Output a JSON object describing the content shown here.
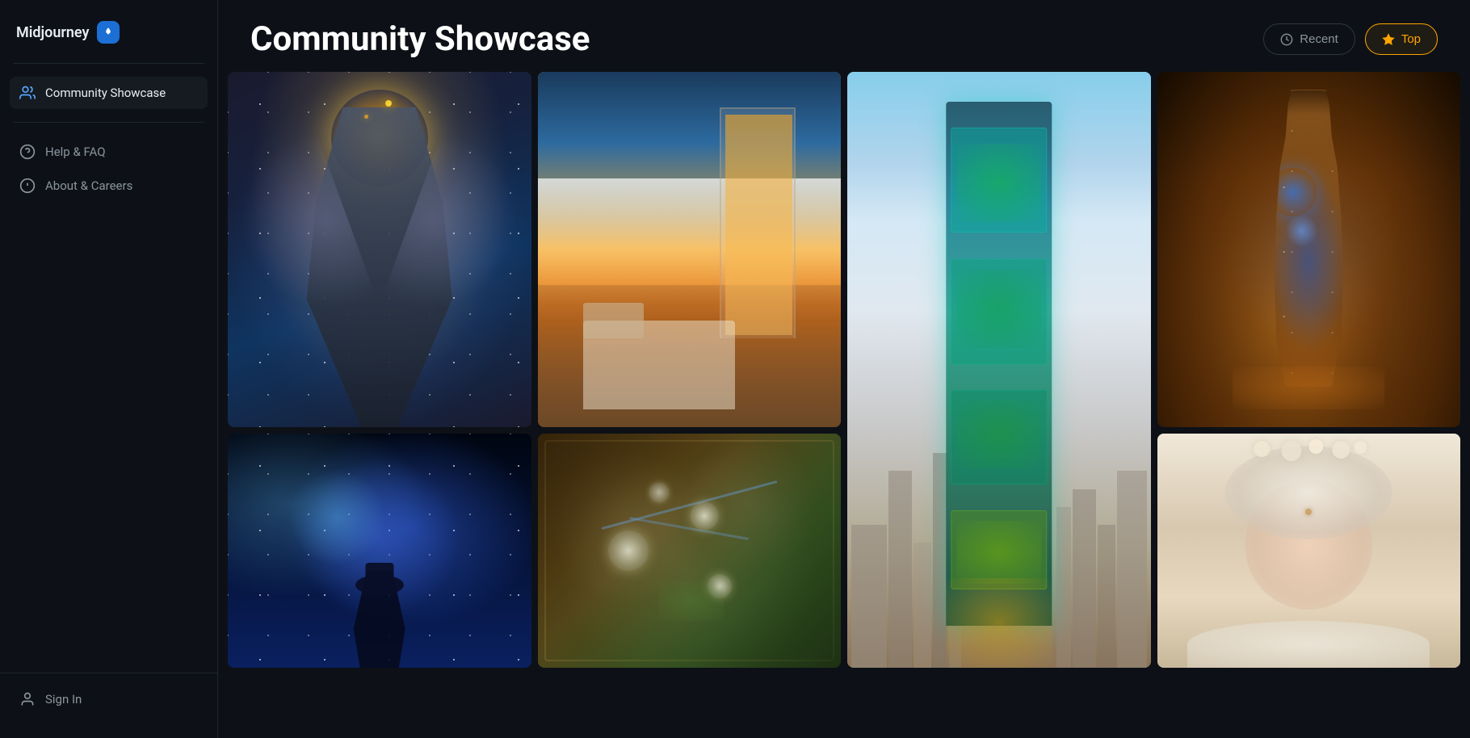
{
  "app": {
    "title": "Midjourney",
    "rocket_icon": "🚀"
  },
  "sidebar": {
    "items": [
      {
        "id": "community-showcase",
        "label": "Community Showcase",
        "icon": "community",
        "active": true
      },
      {
        "id": "help-faq",
        "label": "Help & FAQ",
        "icon": "help",
        "active": false
      },
      {
        "id": "about-careers",
        "label": "About & Careers",
        "icon": "info",
        "active": false
      }
    ],
    "bottom_items": [
      {
        "id": "sign-in",
        "label": "Sign In",
        "icon": "user"
      }
    ]
  },
  "header": {
    "title": "Community Showcase",
    "actions": [
      {
        "id": "recent",
        "label": "Recent",
        "active": false
      },
      {
        "id": "top",
        "label": "Top",
        "active": true
      }
    ]
  },
  "gallery": {
    "images": [
      {
        "id": "zeus",
        "alt": "AI art of Zeus cosmic figure",
        "column": 0
      },
      {
        "id": "bedroom-ocean",
        "alt": "Surreal bedroom with ocean waves",
        "column": 1
      },
      {
        "id": "aqua-tower",
        "alt": "Aquarium skyscraper tower",
        "column": 2
      },
      {
        "id": "bottle-galaxy",
        "alt": "Galaxy in a bottle",
        "column": 3
      },
      {
        "id": "space-cowboy",
        "alt": "Cowboy on horse in space nebula",
        "column": 0
      },
      {
        "id": "fantasy-map",
        "alt": "Ornate fantasy map with orbs",
        "column": 1
      },
      {
        "id": "portrait-flowers",
        "alt": "Portrait with flower crown",
        "column": 3
      }
    ]
  }
}
